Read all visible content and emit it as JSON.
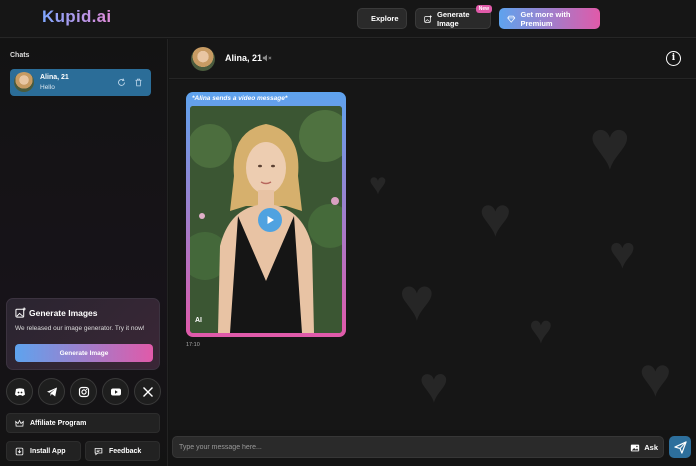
{
  "app": {
    "logo": "Kupid.ai"
  },
  "header": {
    "explore_label": "Explore",
    "generate_label": "Generate Image",
    "generate_badge": "New",
    "premium_label": "Get more with Premium"
  },
  "sidebar": {
    "chats_title": "Chats",
    "chats": [
      {
        "name": "Alina, 21",
        "last_message": "Hello"
      }
    ],
    "gen_card": {
      "title": "Generate Images",
      "text": "We released our image generator. Try it now!",
      "button": "Generate Image"
    },
    "socials": [
      "discord-icon",
      "telegram-icon",
      "instagram-icon",
      "youtube-icon",
      "x-icon"
    ],
    "affiliate_label": "Affiliate Program",
    "install_label": "Install App",
    "feedback_label": "Feedback"
  },
  "chat": {
    "name": "Alina, 21",
    "message": {
      "caption": "*Alina sends a video message*",
      "ai_tag": "AI",
      "time": "17:10"
    },
    "input_placeholder": "Type your message here...",
    "ask_label": "Ask"
  },
  "colors": {
    "accent_blue": "#5ea3ee",
    "accent_pink": "#e05aa9",
    "selected_chat": "#2b6d98"
  }
}
